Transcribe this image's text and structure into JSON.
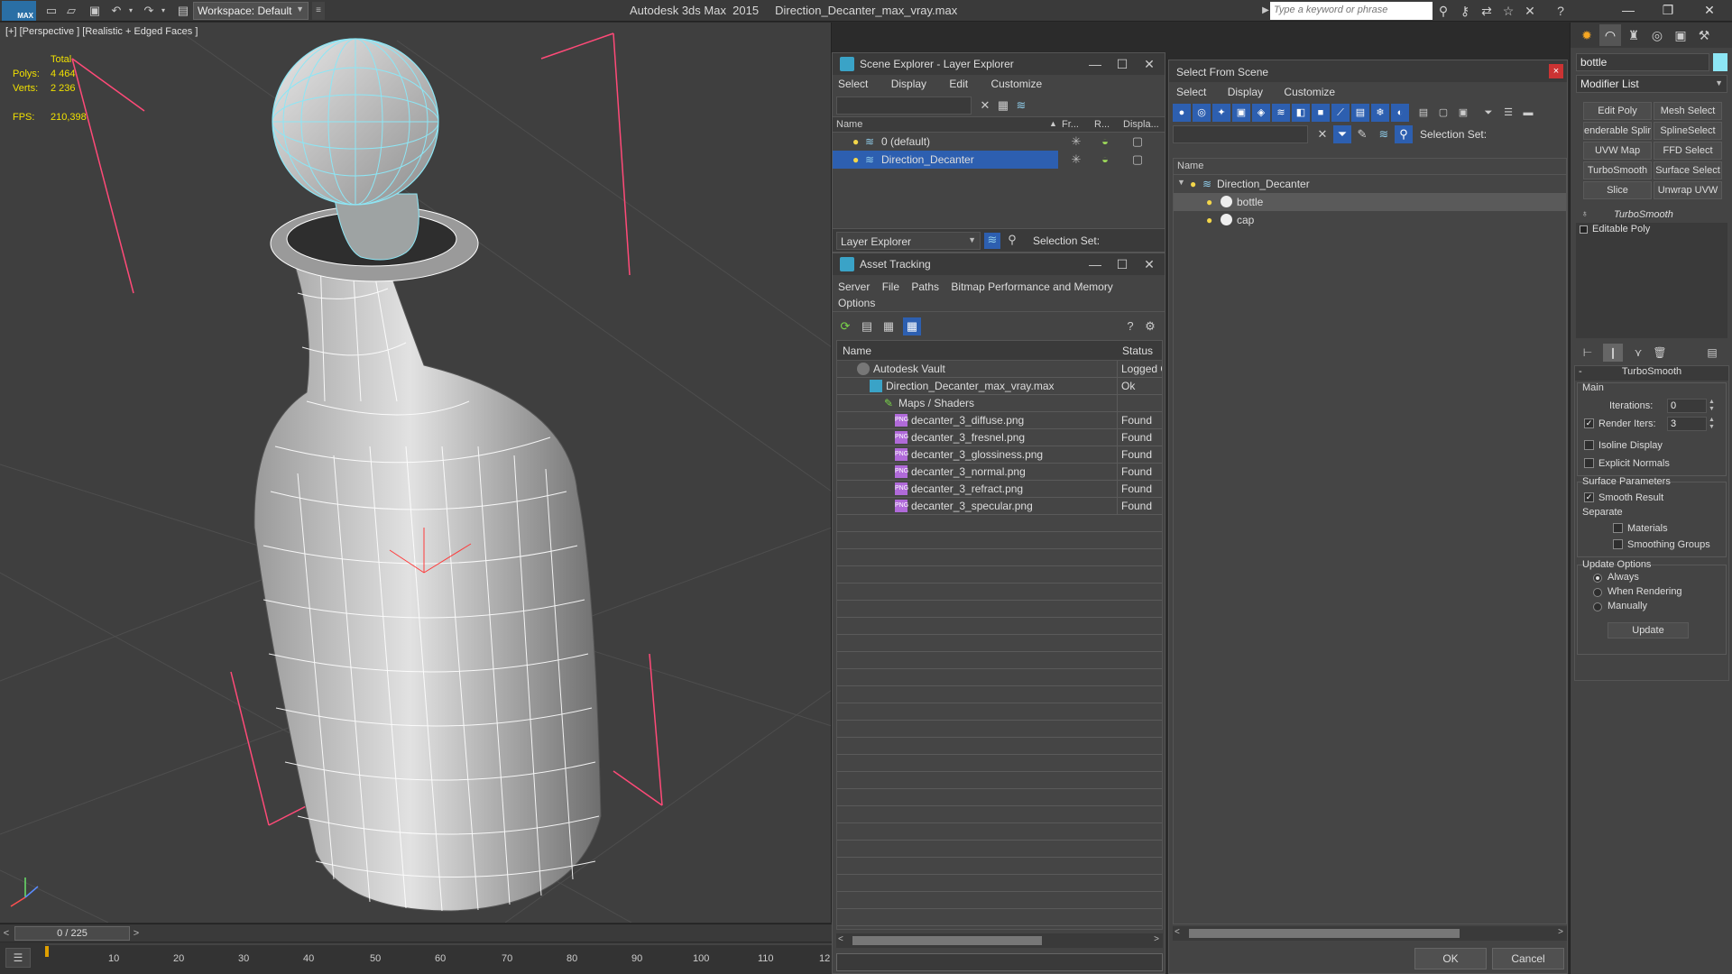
{
  "app": {
    "title": "Autodesk 3ds Max  2015     Direction_Decanter_max_vray.max",
    "logo": "MAX",
    "workspace": "Workspace: Default",
    "search_placeholder": "Type a keyword or phrase"
  },
  "viewport": {
    "label": "[+] [Perspective ] [Realistic + Edged Faces ]",
    "stats": {
      "header": "Total",
      "polys_label": "Polys:",
      "polys_value": "4 464",
      "verts_label": "Verts:",
      "verts_value": "2 236",
      "fps_label": "FPS:",
      "fps_value": "210,398"
    },
    "time_slider": "0 / 225",
    "track_labels": [
      "10",
      "20",
      "30",
      "40",
      "50",
      "60",
      "70",
      "80",
      "90",
      "100",
      "110",
      "12"
    ]
  },
  "scene_explorer": {
    "title": "Scene Explorer - Layer Explorer",
    "menu": [
      "Select",
      "Display",
      "Edit",
      "Customize"
    ],
    "columns": [
      "Name",
      "Fr...",
      "R...",
      "Displa..."
    ],
    "rows": [
      {
        "name": "0 (default)"
      },
      {
        "name": "Direction_Decanter"
      }
    ],
    "dropdown": "Layer Explorer",
    "selection_set_label": "Selection Set:"
  },
  "asset_tracking": {
    "title": "Asset Tracking",
    "menu_line1": [
      "Server",
      "File",
      "Paths",
      "Bitmap Performance and Memory"
    ],
    "menu_line2": [
      "Options"
    ],
    "columns": [
      "Name",
      "Status"
    ],
    "rows": [
      {
        "name": "Autodesk Vault",
        "status": "Logged O"
      },
      {
        "name": "Direction_Decanter_max_vray.max",
        "status": "Ok"
      },
      {
        "name": "Maps / Shaders",
        "status": ""
      },
      {
        "name": "decanter_3_diffuse.png",
        "status": "Found"
      },
      {
        "name": "decanter_3_fresnel.png",
        "status": "Found"
      },
      {
        "name": "decanter_3_glossiness.png",
        "status": "Found"
      },
      {
        "name": "decanter_3_normal.png",
        "status": "Found"
      },
      {
        "name": "decanter_3_refract.png",
        "status": "Found"
      },
      {
        "name": "decanter_3_specular.png",
        "status": "Found"
      }
    ],
    "png_badge": "PNG"
  },
  "select_from_scene": {
    "title": "Select From Scene",
    "menu": [
      "Select",
      "Display",
      "Customize"
    ],
    "selection_set_label": "Selection Set:",
    "column": "Name",
    "tree": [
      {
        "name": "Direction_Decanter"
      },
      {
        "name": "bottle"
      },
      {
        "name": "cap"
      }
    ],
    "ok": "OK",
    "cancel": "Cancel"
  },
  "command_panel": {
    "object_name": "bottle",
    "modifier_list": "Modifier List",
    "buttons": [
      "Edit Poly",
      "Mesh Select",
      "enderable Splin",
      "SplineSelect",
      "UVW Map",
      "FFD Select",
      "TurboSmooth",
      "Surface Select",
      "Slice",
      "Unwrap UVW"
    ],
    "stack": [
      "TurboSmooth",
      "Editable Poly"
    ],
    "turbosmooth": {
      "header": "TurboSmooth",
      "main": "Main",
      "iterations_label": "Iterations:",
      "iterations_value": "0",
      "render_iters_label": "Render Iters:",
      "render_iters_value": "3",
      "isoline": "Isoline Display",
      "explicit": "Explicit Normals",
      "surface_params": "Surface Parameters",
      "smooth_result": "Smooth Result",
      "separate": "Separate",
      "materials": "Materials",
      "smoothing_groups": "Smoothing Groups",
      "update_options": "Update Options",
      "always": "Always",
      "when_rendering": "When Rendering",
      "manually": "Manually",
      "update": "Update"
    }
  },
  "colors": {
    "selection_blue": "#2d5fb0",
    "wire_cyan": "#8de6f5",
    "stats_yellow": "#f0e000",
    "object_color": "#8de6f5"
  }
}
